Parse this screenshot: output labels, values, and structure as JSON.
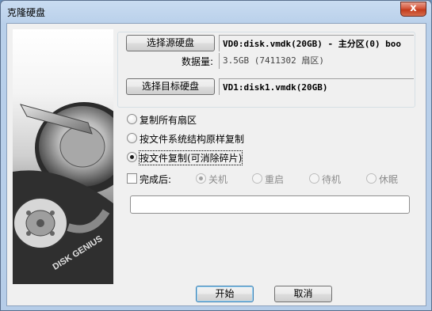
{
  "window": {
    "title": "克隆硬盘",
    "close_glyph": "x"
  },
  "art": {
    "brand_text": "DISK GENIUS"
  },
  "source": {
    "button_label": "选择源硬盘",
    "value": "VD0:disk.vmdk(20GB) - 主分区(0) boo"
  },
  "data_amount": {
    "label": "数据量:",
    "value": "3.5GB (7411302 扇区)"
  },
  "target": {
    "button_label": "选择目标硬盘",
    "value": "VD1:disk1.vmdk(20GB)"
  },
  "copy_modes": [
    {
      "label": "复制所有扇区",
      "checked": false
    },
    {
      "label": "按文件系统结构原样复制",
      "checked": false
    },
    {
      "label": "按文件复制(可消除碎片)",
      "checked": true
    }
  ],
  "after_finish": {
    "label": "完成后:",
    "checked": false,
    "options": [
      {
        "label": "关机",
        "checked": true
      },
      {
        "label": "重启",
        "checked": false
      },
      {
        "label": "待机",
        "checked": false
      },
      {
        "label": "休眠",
        "checked": false
      }
    ]
  },
  "progress": {
    "value": 0
  },
  "buttons": {
    "start": "开始",
    "cancel": "取消"
  }
}
